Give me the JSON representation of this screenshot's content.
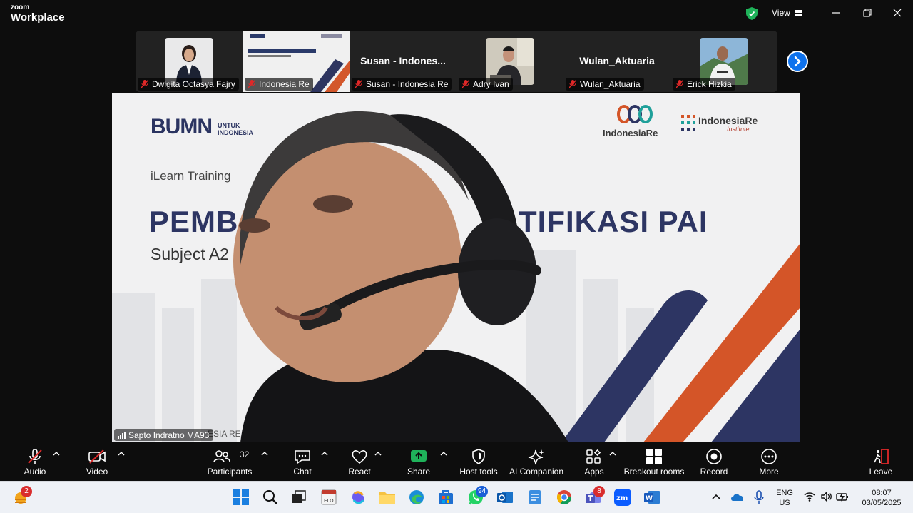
{
  "window": {
    "brand_top": "zoom",
    "brand_bottom": "Workplace",
    "view_label": "View",
    "accent": "#0e72ed",
    "security_color": "#1fb35a"
  },
  "filmstrip": {
    "tiles": [
      {
        "label": "Dwigita Octasya Fajry",
        "name": "",
        "has_video": true
      },
      {
        "label": "Indonesia Re",
        "name": "",
        "has_video": true
      },
      {
        "label": "Susan - Indonesia Re",
        "name": "Susan - Indones...",
        "has_video": false
      },
      {
        "label": "Adry Ivan",
        "name": "",
        "has_video": true
      },
      {
        "label": "Wulan_Aktuaria",
        "name": "Wulan_Aktuaria",
        "has_video": false
      },
      {
        "label": "Erick Hizkia",
        "name": "",
        "has_video": true
      }
    ],
    "next_icon": "chevron-right-icon"
  },
  "main": {
    "speaker_label": "Sapto Indratno MA93",
    "slide": {
      "bumn": "BUMN",
      "bumn_sub1": "UNTUK",
      "bumn_sub2": "INDONESIA",
      "logo1": "IndonesiaRe",
      "logo2": "IndonesiaRe",
      "logo2_sub": "Institute",
      "training": "iLearn Training",
      "title_left": "PEMB",
      "title_right": "TIFIKASI PAI",
      "subject": "Subject A2",
      "footer": "ESIA RE"
    }
  },
  "toolbar": {
    "audio": "Audio",
    "video": "Video",
    "participants": "Participants",
    "participants_count": "32",
    "chat": "Chat",
    "react": "React",
    "share": "Share",
    "host_tools": "Host tools",
    "ai_companion": "AI Companion",
    "apps": "Apps",
    "breakout": "Breakout rooms",
    "record": "Record",
    "more": "More",
    "leave": "Leave",
    "share_color": "#1fb35a",
    "leave_color": "#e02828"
  },
  "taskbar": {
    "weather_badge": "2",
    "whatsapp_badge": "94",
    "teams_badge": "8",
    "lang_top": "ENG",
    "lang_bottom": "US",
    "time": "08:07",
    "date": "03/05/2025"
  }
}
